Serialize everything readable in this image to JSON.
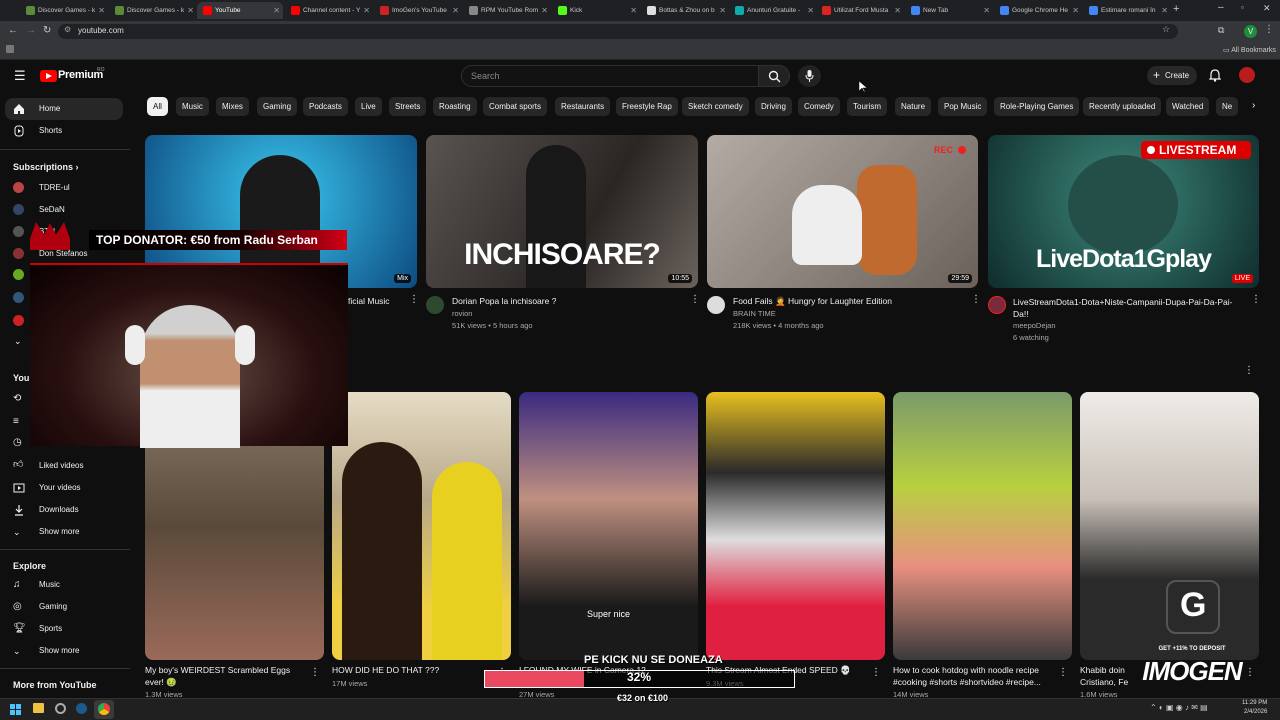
{
  "browser": {
    "tabs": [
      {
        "label": "Discover Games - k",
        "color": "#5a8a3a"
      },
      {
        "label": "Discover Games - k",
        "color": "#5a8a3a"
      },
      {
        "label": "YouTube",
        "color": "#ff0000"
      },
      {
        "label": "Channel content - Y",
        "color": "#ff0000"
      },
      {
        "label": "ImoGen's YouTube",
        "color": "#cc2222"
      },
      {
        "label": "RPM YouTube Rom",
        "color": "#888888"
      },
      {
        "label": "Kick",
        "color": "#53fc18"
      },
      {
        "label": "Bottas & Zhou on b",
        "color": "#dddddd"
      },
      {
        "label": "Anunturi Gratuite -",
        "color": "#1aa"
      },
      {
        "label": "Utilizat Ford Musta",
        "color": "#d22"
      },
      {
        "label": "New Tab",
        "color": "#4285f4"
      },
      {
        "label": "Google Chrome He",
        "color": "#4285f4"
      },
      {
        "label": "Estimare romani în",
        "color": "#4285f4"
      }
    ],
    "url": "youtube.com",
    "all_bookmarks": "All Bookmarks"
  },
  "header": {
    "logo_text": "Premium",
    "region": "RO",
    "search_placeholder": "Search",
    "create_label": "Create"
  },
  "chips": [
    "All",
    "Music",
    "Mixes",
    "Gaming",
    "Podcasts",
    "Live",
    "Streets",
    "Roasting",
    "Combat sports",
    "Restaurants",
    "Freestyle Rap",
    "Sketch comedy",
    "Driving",
    "Comedy",
    "Tourism",
    "Nature",
    "Pop Music",
    "Role-Playing Games",
    "Recently uploaded",
    "Watched",
    "Ne"
  ],
  "sidebar": {
    "home": "Home",
    "shorts": "Shorts",
    "subscriptions": "Subscriptions",
    "subs": [
      {
        "name": "TDRE-ul",
        "color": "#b44"
      },
      {
        "name": "SeDaN",
        "color": "#346"
      },
      {
        "name": "BTN",
        "color": "#555"
      },
      {
        "name": "Don Stefanos",
        "color": "#833"
      }
    ],
    "you": "You",
    "liked": "Liked videos",
    "your_videos": "Your videos",
    "downloads": "Downloads",
    "show_more": "Show more",
    "explore": "Explore",
    "music": "Music",
    "gaming": "Gaming",
    "sports": "Sports",
    "show_more2": "Show more",
    "more_from": "More from YouTube"
  },
  "videos": [
    {
      "title": "ficial Music",
      "meta1": "",
      "meta2": "",
      "badge": "Mix",
      "thumb": "#1c6fa0"
    },
    {
      "title": "Dorian Popa la inchisoare ?",
      "meta1": "rovion",
      "meta2": "51K views • 5 hours ago",
      "dur": "10:55",
      "overlay": "INCHISOARE?",
      "thumb": "#4a4440"
    },
    {
      "title": "Food Fails 🤦 Hungry for Laughter Edition",
      "meta1": "BRAIN TIME",
      "meta2": "218K views • 4 months ago",
      "dur": "29:59",
      "overlay": "REC",
      "thumb": "#7a6e66"
    },
    {
      "title": "LiveStreamDota1-Dota+Niste-Campanii-Dupa-Pai-Da-Pai-Da!!",
      "meta1": "meepoDejan",
      "meta2": "6 watching",
      "badge": "LIVE",
      "overlay": "LIVESTREAM",
      "overlay2": "LiveDota1Gplay",
      "thumb": "#1f4a4a"
    }
  ],
  "shorts": [
    {
      "title": "My boy's WEIRDEST Scrambled Eggs",
      "title2": "ever! 🤢",
      "views": "1.3M views",
      "thumb": "#6a5a4a"
    },
    {
      "title": "HOW DID HE DO THAT ???",
      "views": "17M views",
      "thumb": "#c8b890"
    },
    {
      "title": "I FOUND MY WIFE in Camera 12",
      "views": "27M views",
      "overlay": "Super nice",
      "thumb": "#2a2060"
    },
    {
      "title": "This Stream Almost Ended SPEED 💀",
      "views": "9.3M views",
      "thumb": "#d84050"
    },
    {
      "title": "How to cook hotdog with noodle recipe",
      "title2": "#cooking #shorts #shortvideo #recipe...",
      "views": "14M views",
      "thumb": "#8aaa70"
    },
    {
      "title": "Khabib doin",
      "title2": "Cristiano, Fe",
      "views": "1.6M views",
      "thumb": "#e8e4e0"
    }
  ],
  "overlay": {
    "donator": "TOP DONATOR: €50 from Radu Serban",
    "goal_title": "PE KICK NU SE DONEAZA",
    "goal_percent_label": "32%",
    "goal_percent": 32,
    "goal_amount": "€32 on €100",
    "brand": "IMOGEN",
    "promo": "GET +11% TO DEPOSIT"
  },
  "taskbar": {
    "time": "11:29 PM",
    "date": "2/4/2026"
  }
}
